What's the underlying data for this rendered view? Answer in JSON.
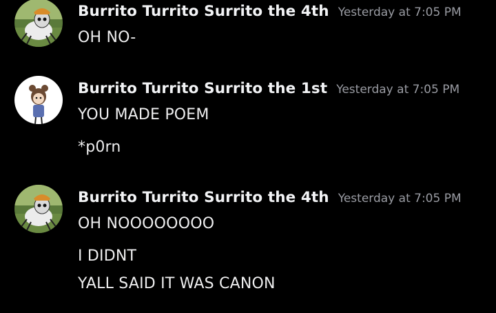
{
  "messages": [
    {
      "username": "Burrito Turrito Surrito the 4th",
      "timestamp": "Yesterday at 7:05 PM",
      "avatar_icon": "spider-creature-avatar",
      "lines": [
        "OH NO-"
      ]
    },
    {
      "username": "Burrito Turrito Surrito the 1st",
      "timestamp": "Yesterday at 7:05 PM",
      "avatar_icon": "drawn-girl-avatar",
      "lines": [
        "YOU MADE POEM",
        "*p0rn"
      ]
    },
    {
      "username": "Burrito Turrito Surrito the 4th",
      "timestamp": "Yesterday at 7:05 PM",
      "avatar_icon": "spider-creature-avatar",
      "lines": [
        "OH NOOOOOOOO",
        "I DIDNT",
        "YALL SAID IT WAS CANON"
      ]
    }
  ],
  "colors": {
    "background": "#000000",
    "username": "#f2f3f5",
    "timestamp": "#9a9ca3",
    "message_text": "#eeeeef"
  }
}
